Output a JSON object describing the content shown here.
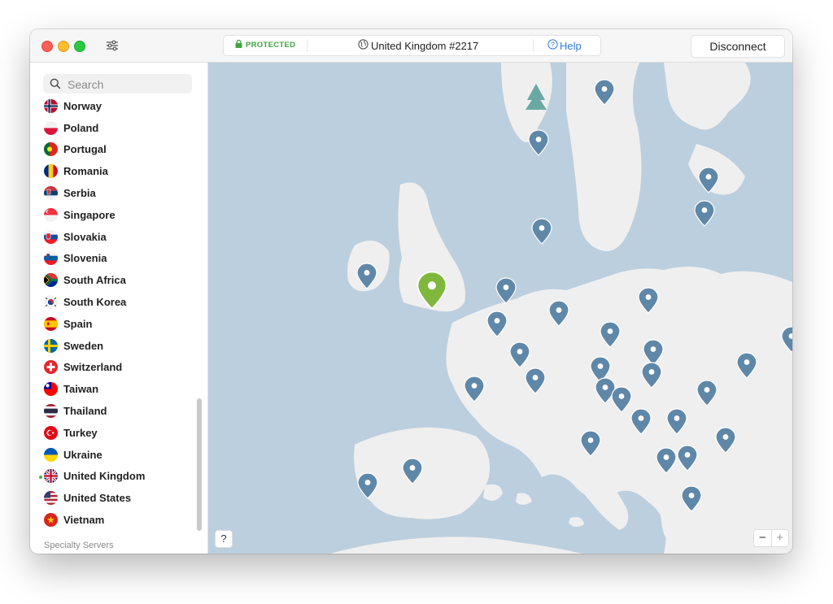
{
  "titlebar": {
    "status": "PROTECTED",
    "server": "United Kingdom #2217",
    "help": "Help",
    "disconnect": "Disconnect"
  },
  "sidebar": {
    "search_placeholder": "Search",
    "countries": [
      {
        "name": "Norway",
        "flag": "norway"
      },
      {
        "name": "Poland",
        "flag": "poland"
      },
      {
        "name": "Portugal",
        "flag": "portugal"
      },
      {
        "name": "Romania",
        "flag": "romania"
      },
      {
        "name": "Serbia",
        "flag": "serbia"
      },
      {
        "name": "Singapore",
        "flag": "singapore"
      },
      {
        "name": "Slovakia",
        "flag": "slovakia"
      },
      {
        "name": "Slovenia",
        "flag": "slovenia"
      },
      {
        "name": "South Africa",
        "flag": "south-africa"
      },
      {
        "name": "South Korea",
        "flag": "south-korea"
      },
      {
        "name": "Spain",
        "flag": "spain"
      },
      {
        "name": "Sweden",
        "flag": "sweden"
      },
      {
        "name": "Switzerland",
        "flag": "switzerland"
      },
      {
        "name": "Taiwan",
        "flag": "taiwan"
      },
      {
        "name": "Thailand",
        "flag": "thailand"
      },
      {
        "name": "Turkey",
        "flag": "turkey"
      },
      {
        "name": "Ukraine",
        "flag": "ukraine"
      },
      {
        "name": "United Kingdom",
        "flag": "united-kingdom",
        "connected": true
      },
      {
        "name": "United States",
        "flag": "united-states"
      },
      {
        "name": "Vietnam",
        "flag": "vietnam"
      }
    ],
    "specialty_label": "Specialty Servers"
  },
  "map": {
    "help_label": "?",
    "zoom_out": "−",
    "zoom_in": "+",
    "pin_color": "#5f87a8",
    "active_pin_color": "#7fb83c"
  }
}
